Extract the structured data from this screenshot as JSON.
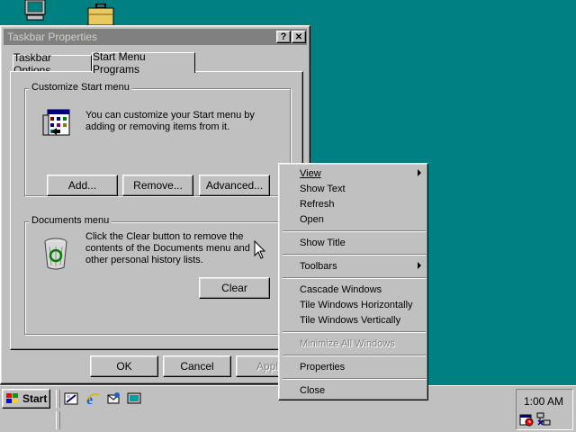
{
  "window": {
    "title": "Taskbar Properties",
    "help_label": "?",
    "close_label": "✕"
  },
  "tabs": [
    {
      "label": "Taskbar Options"
    },
    {
      "label": "Start Menu Programs"
    }
  ],
  "customize": {
    "legend": "Customize Start menu",
    "description": "You can customize your Start menu by adding or removing items from it.",
    "add_label": "Add...",
    "remove_label": "Remove...",
    "advanced_label": "Advanced..."
  },
  "documents": {
    "legend": "Documents menu",
    "description": "Click the Clear button to remove the contents of the Documents menu and other personal history lists.",
    "clear_label": "Clear"
  },
  "dialog_buttons": {
    "ok_label": "OK",
    "cancel_label": "Cancel",
    "apply_label": "Apply"
  },
  "context_menu": {
    "items": [
      {
        "label": "View"
      },
      {
        "label": "Show Text"
      },
      {
        "label": "Refresh"
      },
      {
        "label": "Open"
      },
      {
        "label": "Show Title"
      },
      {
        "label": "Toolbars"
      },
      {
        "label": "Cascade Windows"
      },
      {
        "label": "Tile Windows Horizontally"
      },
      {
        "label": "Tile Windows Vertically"
      },
      {
        "label": "Minimize All Windows"
      },
      {
        "label": "Properties"
      },
      {
        "label": "Close"
      }
    ]
  },
  "taskbar": {
    "start_label": "Start",
    "clock": "1:00 AM"
  },
  "icons": {
    "desktop": [
      "my-computer-icon",
      "briefcase-icon"
    ],
    "quick_launch": [
      "show-desktop-icon",
      "internet-explorer-icon",
      "outlook-express-icon",
      "channels-icon"
    ],
    "tray": [
      "scheduler-icon",
      "network-icon"
    ]
  },
  "colors": {
    "desktop": "#008080",
    "face": "#c0c0c0",
    "inactive_title": "#808080"
  }
}
